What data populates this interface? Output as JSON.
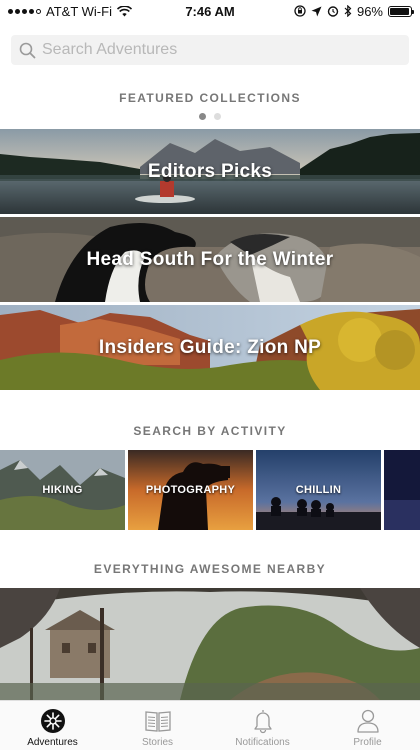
{
  "status_bar": {
    "carrier": "AT&T Wi-Fi",
    "time": "7:46 AM",
    "battery": "96%",
    "battery_level": 0.96
  },
  "search": {
    "placeholder": "Search Adventures"
  },
  "featured": {
    "title": "FEATURED COLLECTIONS",
    "pages": 2,
    "active_page": 1,
    "collections": [
      {
        "label": "Editors Picks"
      },
      {
        "label": "Head South For the Winter"
      },
      {
        "label": "Insiders Guide: Zion NP"
      }
    ]
  },
  "activity": {
    "title": "SEARCH BY ACTIVITY",
    "items": [
      {
        "label": "HIKING"
      },
      {
        "label": "PHOTOGRAPHY"
      },
      {
        "label": "CHILLIN"
      }
    ]
  },
  "nearby": {
    "title": "EVERYTHING AWESOME NEARBY"
  },
  "tabs": [
    {
      "label": "Adventures",
      "icon": "compass-icon",
      "active": true
    },
    {
      "label": "Stories",
      "icon": "book-icon",
      "active": false
    },
    {
      "label": "Notifications",
      "icon": "bell-icon",
      "active": false
    },
    {
      "label": "Profile",
      "icon": "person-icon",
      "active": false
    }
  ]
}
